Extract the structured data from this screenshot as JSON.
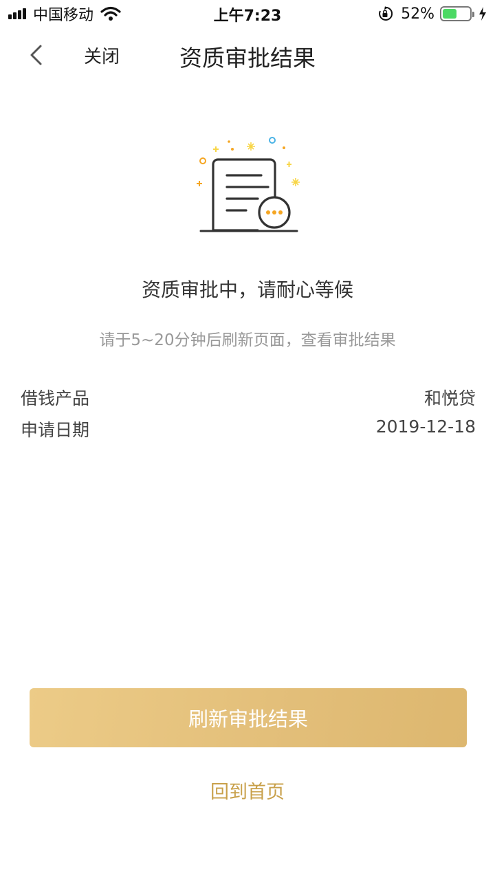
{
  "status_bar": {
    "carrier": "中国移动",
    "time": "上午7:23",
    "battery_percent": "52%",
    "battery_level": 0.52,
    "battery_color": "#4cd964"
  },
  "nav": {
    "back_icon": "chevron-left-icon",
    "close_label": "关闭",
    "title": "资质审批结果"
  },
  "illustration": {
    "icon": "document-pending-icon",
    "accent_colors": [
      "#f5a623",
      "#f8d648",
      "#4ab3e6",
      "#f5a623"
    ]
  },
  "message": {
    "main": "资质审批中，请耐心等候",
    "sub": "请于5~20分钟后刷新页面，查看审批结果"
  },
  "details": [
    {
      "label": "借钱产品",
      "value": "和悦贷"
    },
    {
      "label": "申请日期",
      "value": "2019-12-18"
    }
  ],
  "actions": {
    "refresh_label": "刷新审批结果",
    "home_label": "回到首页",
    "brand_color": "#e3bf7a"
  }
}
